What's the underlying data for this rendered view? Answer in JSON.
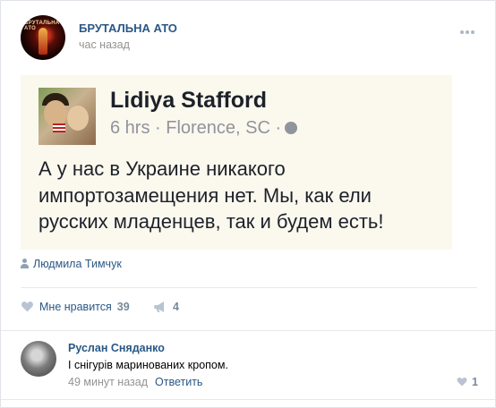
{
  "post": {
    "group_name": "БРУТАЛЬНА АТО",
    "time": "час назад",
    "avatar_logo_text": "БРУТАЛЬНА АТО"
  },
  "quoted_post": {
    "author": "Lidiya Stafford",
    "meta": "6 hrs · Florence, SC ·",
    "text": "А у нас в Украине никакого импортозамещения нет. Мы, как ели русских младенцев, так и будем есть!"
  },
  "signature": {
    "author": "Людмила Тимчук"
  },
  "actions": {
    "like_label": "Мне нравится",
    "like_count": "39",
    "share_count": "4"
  },
  "comment": {
    "author": "Руслан Сняданко",
    "text": "І снігурів маринованих кропом.",
    "time": "49 минут назад",
    "reply_label": "Ответить",
    "like_count": "1"
  },
  "colors": {
    "link": "#2a5885",
    "muted": "#939393",
    "count": "#768899",
    "quote_bg": "#fbf8ee"
  },
  "icons": [
    "more-icon",
    "globe-icon",
    "person-icon",
    "heart-icon",
    "megaphone-icon",
    "small-heart-icon"
  ]
}
